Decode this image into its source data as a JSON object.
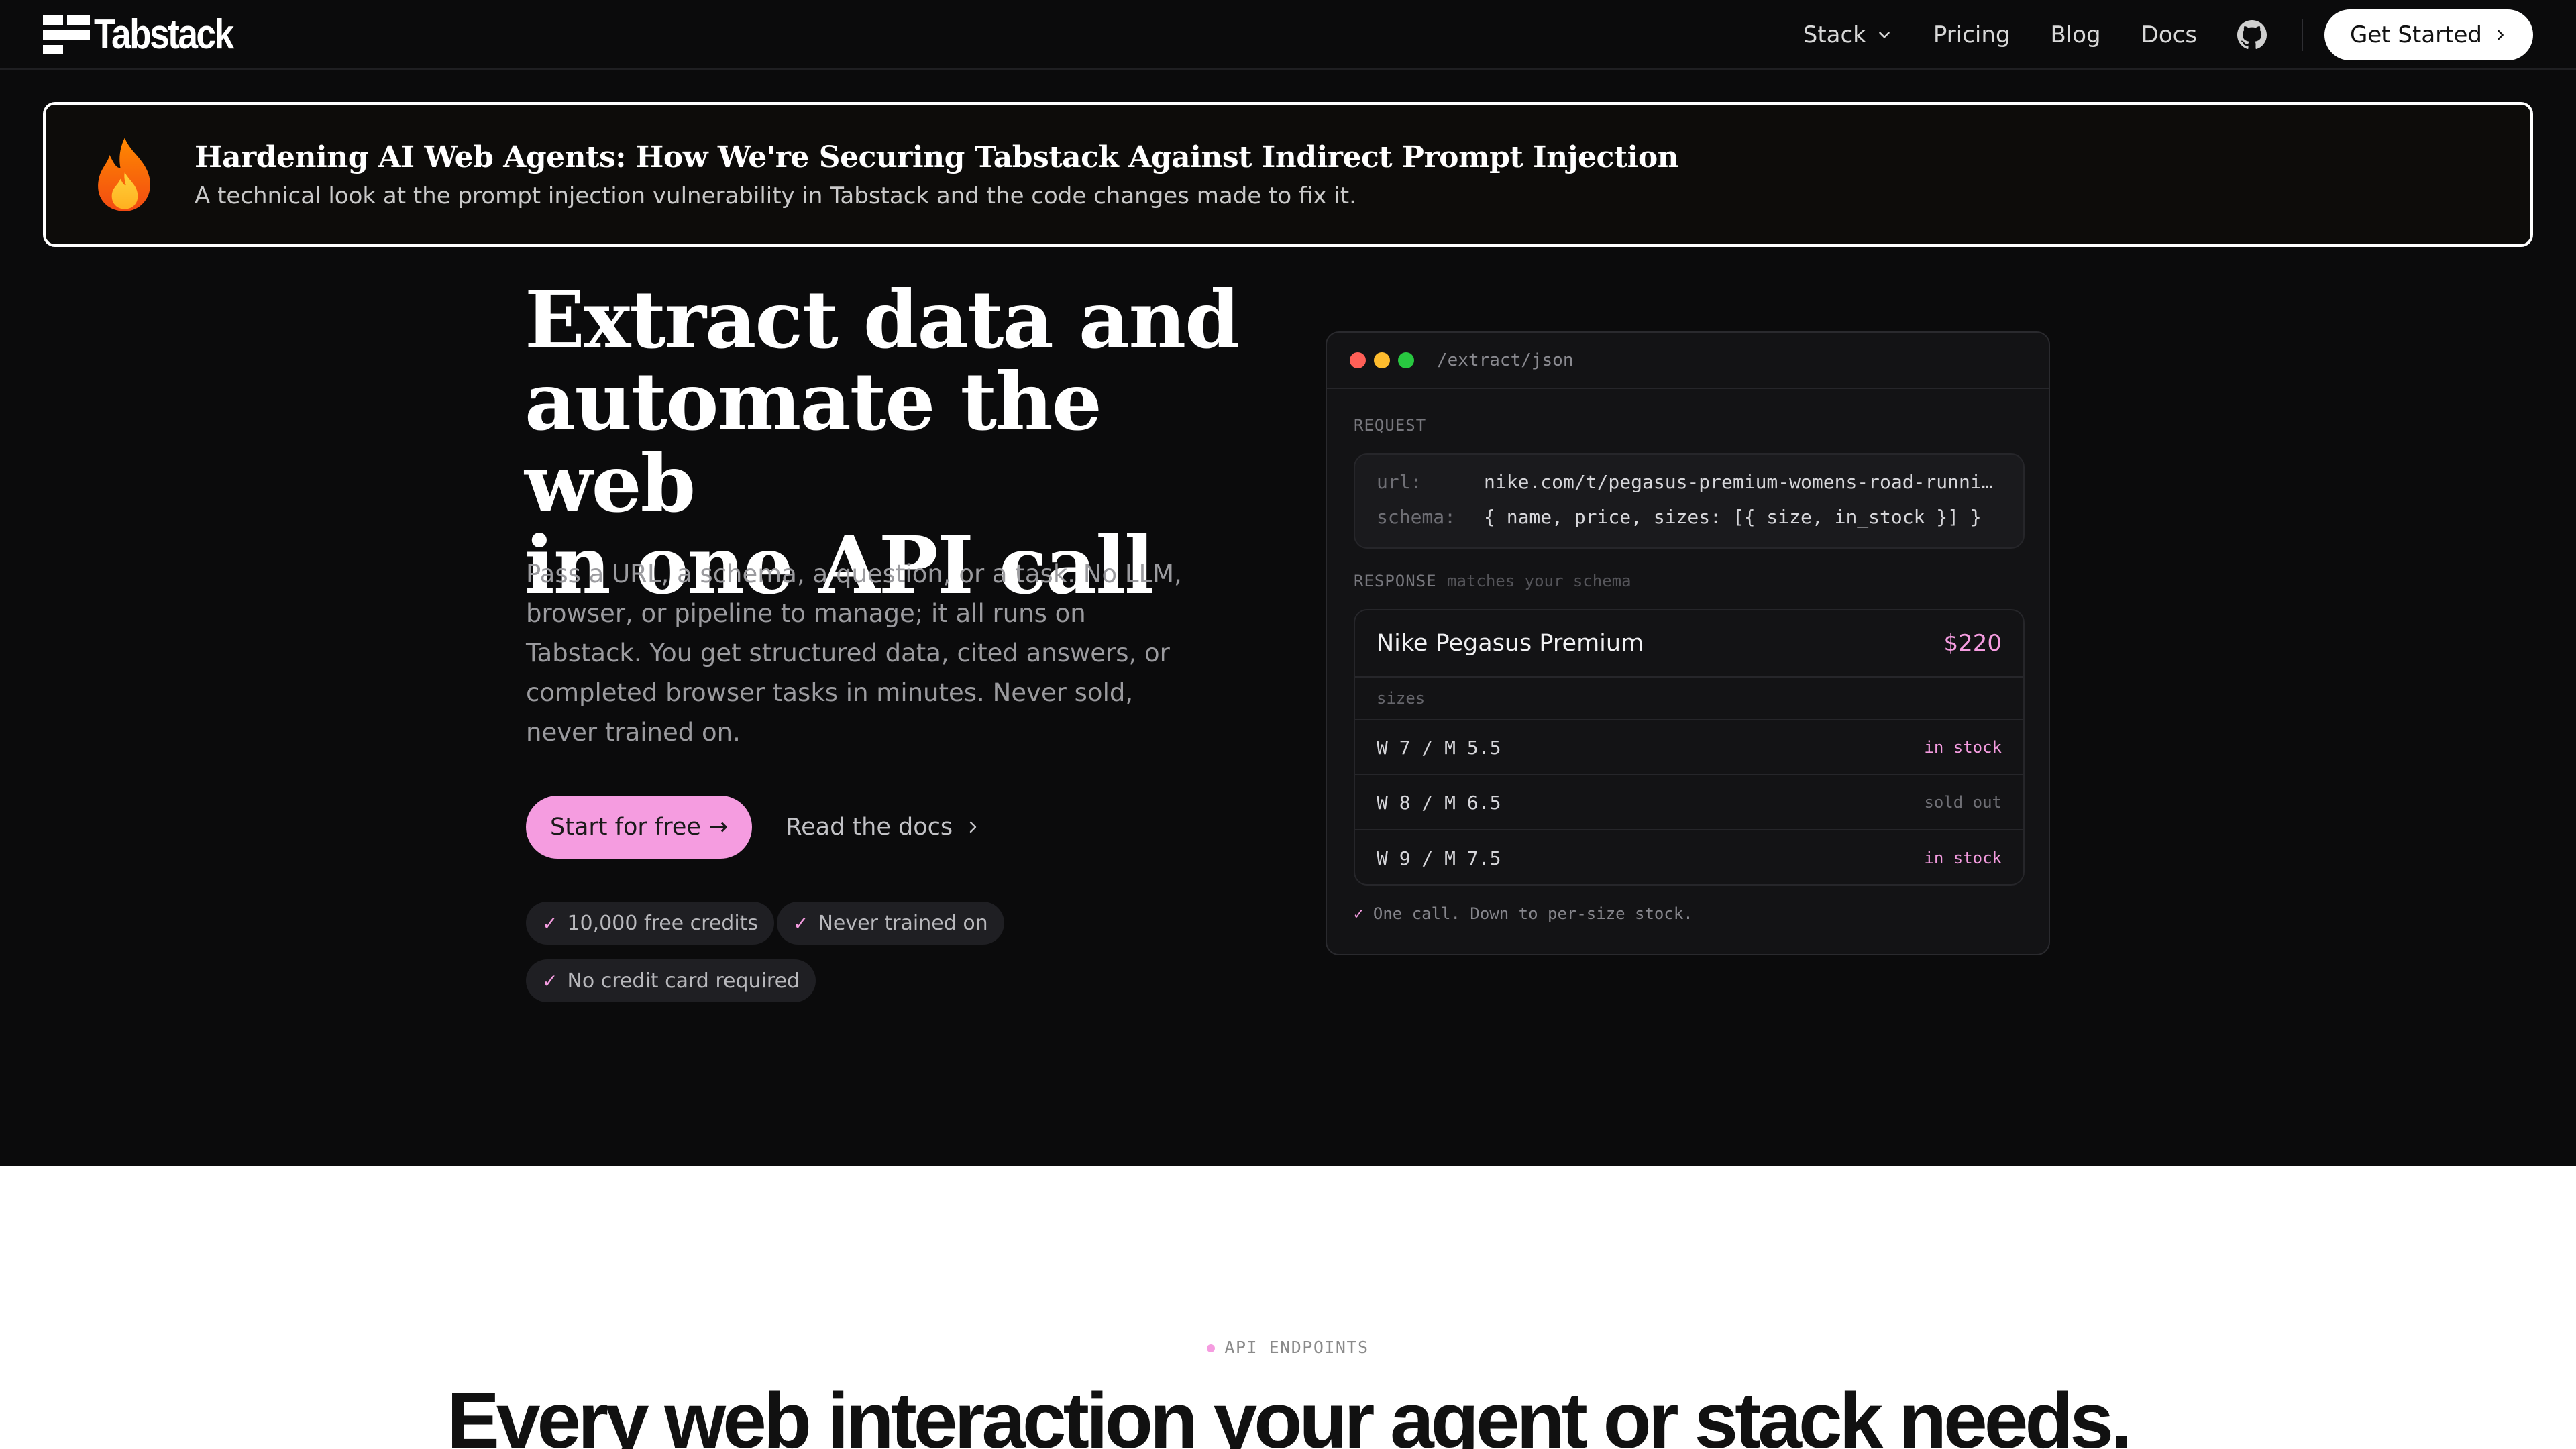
{
  "nav": {
    "logo_text": "Tabstack",
    "links": [
      "Stack",
      "Pricing",
      "Blog",
      "Docs"
    ],
    "cta_label": "Get Started"
  },
  "banner": {
    "title": "Hardening AI Web Agents: How We're Securing Tabstack Against Indirect Prompt Injection",
    "subtitle": "A technical look at the prompt injection vulnerability in Tabstack and the code changes made to fix it."
  },
  "hero": {
    "title_lines": [
      "Extract data and",
      "automate the web",
      "in one API call"
    ],
    "description": "Pass a URL, a schema, a question, or a task. No LLM, browser, or pipeline to manage; it all runs on Tabstack. You get structured data, cited answers, or completed browser tasks in minutes. Never sold, never trained on.",
    "primary_cta": "Start for free →",
    "secondary_cta": "Read the docs",
    "chips": [
      "10,000 free credits",
      "Never trained on",
      "No credit card required"
    ],
    "check": "✓"
  },
  "card": {
    "path": "/extract/json",
    "request_label": "REQUEST",
    "request": {
      "url_key": "url:",
      "url_val": "nike.com/t/pegasus-premium-womens-road-runni…",
      "schema_key": "schema:",
      "schema_val": "{ name, price, sizes: [{ size, in_stock }] }"
    },
    "response_label": "RESPONSE",
    "response_note": "matches your schema",
    "product_name": "Nike Pegasus Premium",
    "product_price": "$220",
    "sizes_label": "sizes",
    "sizes": [
      {
        "size": "W 7 / M 5.5",
        "status": "in stock"
      },
      {
        "size": "W 8 / M 6.5",
        "status": "sold out"
      },
      {
        "size": "W 9 / M 7.5",
        "status": "in stock"
      }
    ],
    "footer": "One call. Down to per-size stock."
  },
  "section": {
    "label": "API ENDPOINTS",
    "title": "Every web interaction your agent or stack needs."
  },
  "colors": {
    "accent_pink": "#f59ce0",
    "background_dark": "#0b0b0c",
    "dot_red": "#ff5f57",
    "dot_yellow": "#febc2e",
    "dot_green": "#28c840",
    "stock_in": "#f59ce0",
    "stock_out": "#6f6f75"
  },
  "icons": [
    "chevron-down-icon",
    "github-icon",
    "chevron-right-icon",
    "fire-icon",
    "check-icon"
  ]
}
